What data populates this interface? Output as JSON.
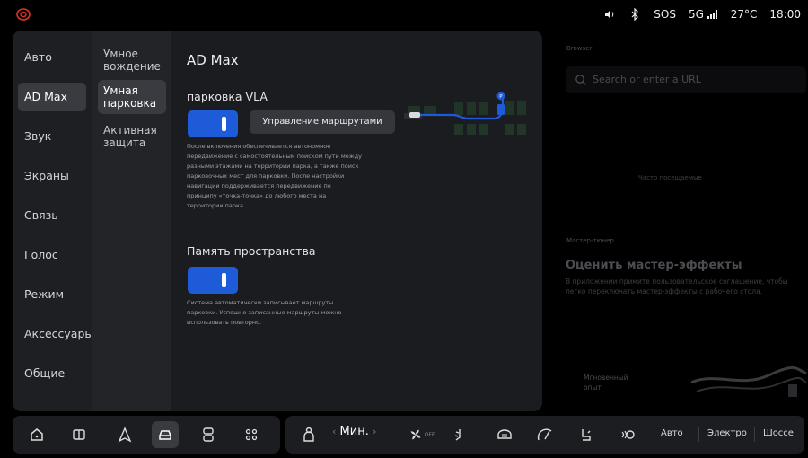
{
  "status_bar": {
    "sos": "SOS",
    "network": "5G",
    "temperature": "27°C",
    "time": "18:00"
  },
  "nav": {
    "items": [
      {
        "label": "Авто"
      },
      {
        "label": "AD Max",
        "active": true
      },
      {
        "label": "Звук"
      },
      {
        "label": "Экраны"
      },
      {
        "label": "Связь"
      },
      {
        "label": "Голос"
      },
      {
        "label": "Режим"
      },
      {
        "label": "Аксессуары"
      },
      {
        "label": "Общие"
      }
    ]
  },
  "subnav": {
    "items": [
      {
        "label": "Умное вождение"
      },
      {
        "label": "Умная парковка",
        "active": true
      },
      {
        "label": "Активная защита"
      }
    ]
  },
  "content": {
    "title": "AD Max",
    "vla": {
      "title": "парковка VLA",
      "enabled": true,
      "route_button": "Управление маршрутами",
      "description": "После включения обеспечивается автономное передвижение с самостоятельным поиском пути между разными этажами на территории парка, а также поиск парковочных мест для парковки. После настройки навигации поддерживается передвижение по принципу «точка-точка» до любого места на территории парка"
    },
    "memory": {
      "title": "Память пространства",
      "enabled": true,
      "description": "Система автоматически записывает маршруты парковки. Успешно записанные маршруты можно использовать повторно."
    }
  },
  "right_panel": {
    "browser_label": "Browser",
    "search_placeholder": "Search or enter a URL",
    "bookmark_hint": "Часто посещаемые",
    "tuner_label": "Мастер-тюнер",
    "tuner_title": "Оценить мастер-эффекты",
    "tuner_desc": "В приложении примите пользовательское соглашение, чтобы легко переключать мастер-эффекты с рабочего стола.",
    "instant_label": "Мгновенный опыт"
  },
  "dock": {
    "fan_mode": "Мин.",
    "fan_off": "OFF",
    "modes": [
      "Авто",
      "Электро",
      "Шоссе"
    ]
  },
  "colors": {
    "accent": "#1e5bd8",
    "brand_red": "#e0332b",
    "panel_bg": "#1b1c20"
  }
}
